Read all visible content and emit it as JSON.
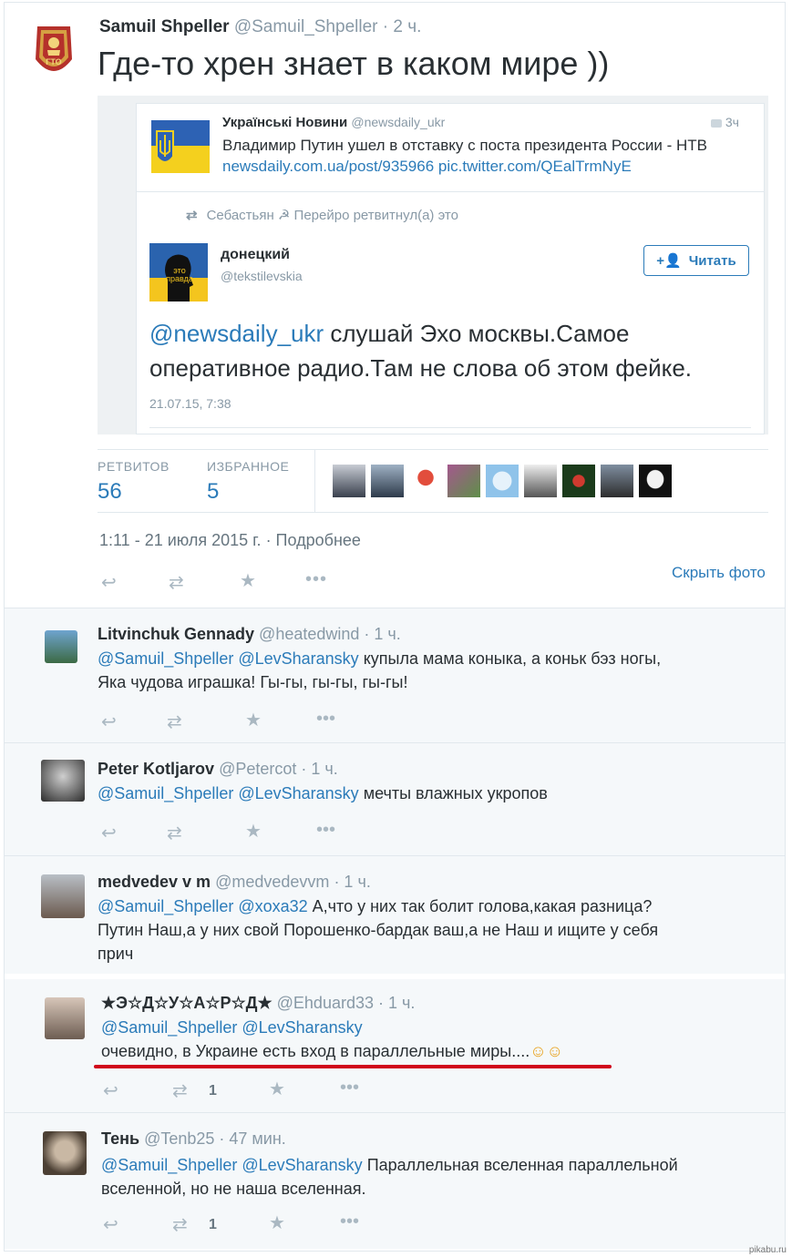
{
  "main_tweet": {
    "author_name": "Samuil Shpeller",
    "author_handle": "@Samuil_Shpeller",
    "time": "· 2 ч.",
    "text": "Где-то хрен знает в каком мире ))",
    "quoted": {
      "news": {
        "name": "Українські Новини",
        "handle": "@newsdaily_ukr",
        "time": "3ч",
        "text": "Владимир Путин ушел в отставку с поста президента России - НТВ",
        "links": "newsdaily.com.ua/post/935966 pic.twitter.com/QEalTrmNyE"
      },
      "retweet_note": "Себастьян ☭ Перейро ретвитнул(а) это",
      "inner": {
        "name": "донецкий",
        "handle": "@tekstilevskia",
        "follow_label": "Читать",
        "mention": "@newsdaily_ukr",
        "text_line1": " слушай Эхо москвы.Самое",
        "text_line2": "оперативное радио.Там не слова об этом фейке.",
        "date": "21.07.15, 7:38",
        "avatar_text": "это\nправда"
      }
    },
    "stats": {
      "retweets_label": "РЕТВИТОВ",
      "retweets_value": "56",
      "favorites_label": "ИЗБРАННОЕ",
      "favorites_value": "5"
    },
    "timestamp": "1:11 - 21 июля 2015 г.",
    "details_link": "· Подробнее",
    "hide_photo": "Скрыть фото"
  },
  "replies": [
    {
      "name": "Litvinchuk Gennady",
      "handle": "@heatedwind",
      "time": "· 1 ч.",
      "mentions": "@Samuil_Shpeller @LevSharansky",
      "text": " купыла мама коныка, а коньк бэз ногы,",
      "text2": "Яка чудова играшка! Гы-гы, гы-гы, гы-гы!",
      "retweet_count": ""
    },
    {
      "name": "Peter Kotljarov",
      "handle": "@Petercot",
      "time": "· 1 ч.",
      "mentions": "@Samuil_Shpeller @LevSharansky",
      "text": "  мечты влажных укропов",
      "text2": "",
      "retweet_count": ""
    },
    {
      "name": "medvedev v m",
      "handle": "@medvedevvm",
      "time": "· 1 ч.",
      "mentions": "@Samuil_Shpeller @xoxa32",
      "text": " А,что у них так болит голова,какая разница?",
      "text2": "Путин Наш,а у них свой Порошенко-бардак ваш,а не Наш и ищите у себя",
      "text3": "прич",
      "retweet_count": ""
    },
    {
      "name": "★Э☆Д☆У☆А☆Р☆Д★",
      "handle": "@Ehduard33",
      "time": "· 1 ч.",
      "mentions": "@Samuil_Shpeller @LevSharansky",
      "text2": "очевидно, в Украине есть вход в параллельные миры....",
      "emoji": "☺☺",
      "retweet_count": "1"
    },
    {
      "name": "Тень",
      "handle": "@Tenb25",
      "time": "· 47 мин.",
      "mentions": "@Samuil_Shpeller @LevSharansky",
      "text": " Параллельная вселенная параллельной",
      "text2": "вселенной, но не наша вселенная.",
      "retweet_count": "1"
    }
  ],
  "watermark": "pikabu.ru",
  "colors": {
    "link": "#2b7bb9",
    "muted": "#8899a6",
    "reply_bg": "#f5f8fa",
    "underline": "#d0021b"
  },
  "icons": [
    "reply-icon",
    "retweet-icon",
    "favorite-icon",
    "more-icon"
  ]
}
